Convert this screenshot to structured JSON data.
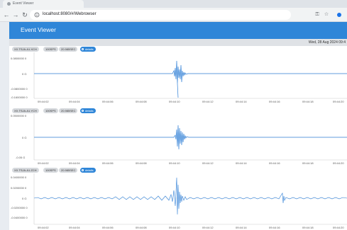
{
  "browser": {
    "tab_title": "Event Viewer",
    "url": "localhost:8080/#/Webrowser"
  },
  "app": {
    "title": "Event Viewer",
    "date": "Wed, 28 Aug 2024 09:4"
  },
  "panels": [
    {
      "station": "XX.TSJA.A1.XCH",
      "sps": "100SPS",
      "duration": "20.985SEC",
      "details_label": "details",
      "y_labels": [
        "0.0800000\n0",
        "0 G",
        "-0.0800000\n0",
        "-0.1600000\n0"
      ],
      "x_labels": [
        "09:44:02",
        "09:44:04",
        "09:44:06",
        "09:44:08",
        "09:44:10",
        "09:44:12",
        "09:44:14",
        "09:44:16",
        "09:44:18",
        "09:44:20"
      ]
    },
    {
      "station": "XX.TSJA.A1.YCH",
      "sps": "100SPS",
      "duration": "20.985SEC",
      "details_label": "details",
      "y_labels": [
        "0.0500000\n0",
        "0 G",
        "-0.05 G"
      ],
      "x_labels": [
        "09:44:02",
        "09:44:04",
        "09:44:06",
        "09:44:08",
        "09:44:10",
        "09:44:12",
        "09:44:14",
        "09:44:16",
        "09:44:18",
        "09:44:20"
      ]
    },
    {
      "station": "XX.TSJA.A1.ZCH",
      "sps": "100SPS",
      "duration": "20.985SEC",
      "details_label": "details",
      "y_labels": [
        "0.0400000\n0",
        "0.0200000\n0",
        "0 G",
        "-0.0200000\n0",
        "-0.0400000\n0"
      ],
      "x_labels": [
        "09:44:02",
        "09:44:04",
        "09:44:06",
        "09:44:08",
        "09:44:10",
        "09:44:12",
        "09:44:14",
        "09:44:16",
        "09:44:18",
        "09:44:20"
      ]
    }
  ],
  "colors": {
    "accent": "#2f86d8",
    "trace": "#2f7fd6"
  },
  "icons": [
    "back-icon",
    "forward-icon",
    "reload-icon",
    "info-icon",
    "key-icon",
    "star-icon",
    "profile-icon"
  ]
}
